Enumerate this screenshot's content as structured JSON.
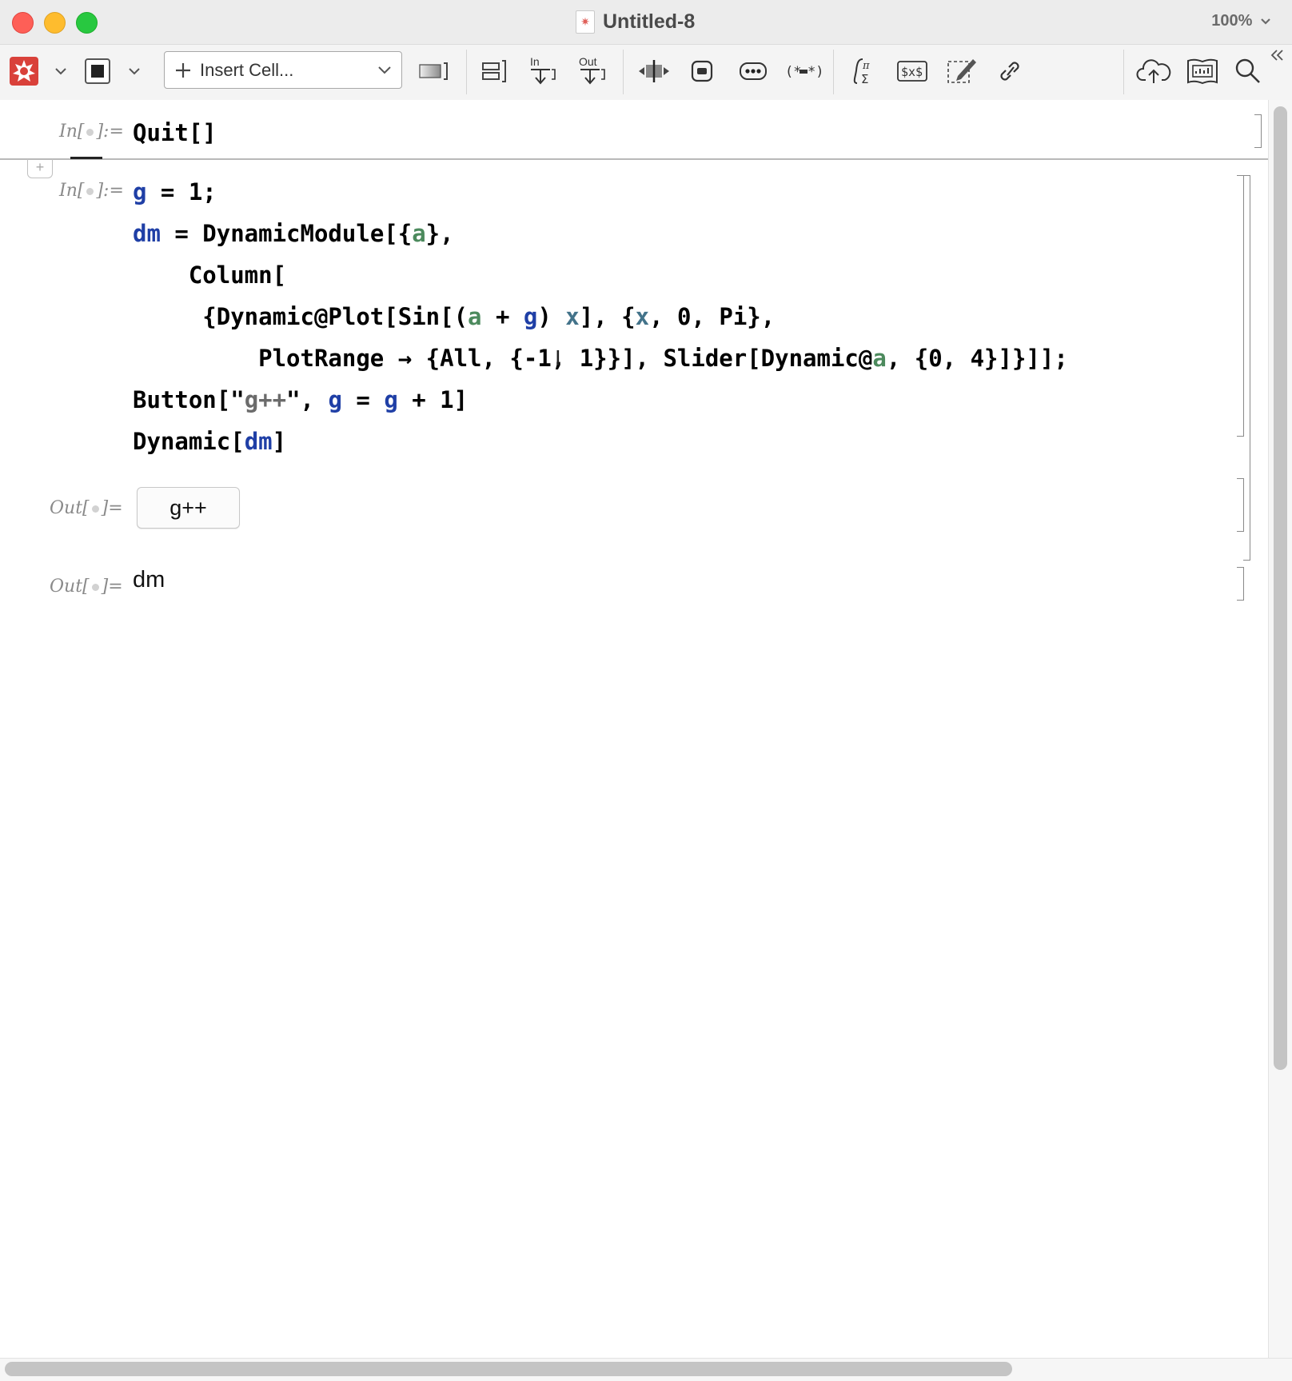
{
  "window": {
    "title": "Untitled-8",
    "zoom": "100%"
  },
  "toolbar": {
    "insert_cell_label": "Insert Cell...",
    "icons": [
      "wolfram-menu-icon",
      "evaluation-stop-icon",
      "insert-cell-dropdown",
      "style-frame-icon",
      "cell-group-icon",
      "input-below-icon",
      "output-below-icon",
      "toggle-icon",
      "cell-close-icon",
      "ellipsis-icon",
      "comment-icon",
      "math-typeset-icon",
      "tex-icon",
      "drawing-icon",
      "hyperlink-icon",
      "cloud-publish-icon",
      "presenter-icon",
      "search-icon",
      "collapse-toolbar-icon"
    ],
    "in_label": "In",
    "out_label": "Out"
  },
  "cells": {
    "quit": {
      "label_prefix": "In[",
      "label_suffix": "]:=",
      "code": "Quit[]"
    },
    "main": {
      "label_prefix": "In[",
      "label_suffix": "]:="
    },
    "out1": {
      "label_prefix": "Out[",
      "label_suffix": "]=",
      "button_label": "g++"
    },
    "out2": {
      "label_prefix": "Out[",
      "label_suffix": "]=",
      "value": "dm"
    }
  },
  "colors": {
    "global_symbol": "#1f3fa6",
    "local_symbol": "#4c8a5d",
    "iterator": "#43738a"
  }
}
